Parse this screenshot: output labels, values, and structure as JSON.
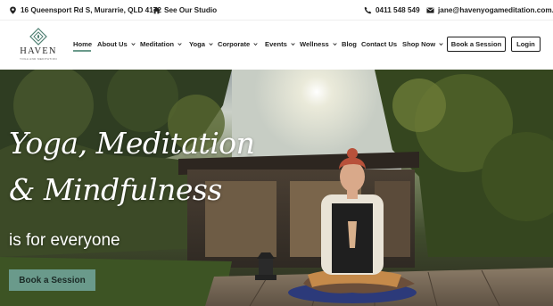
{
  "topbar": {
    "address": "16 Queensport Rd S, Murarrie, QLD 4172",
    "studio_link": "See Our Studio",
    "phone": "0411 548 549",
    "email": "jane@havenyogameditation.com.au"
  },
  "logo": {
    "name": "HAVEN",
    "tagline": "YOGA AND MEDITATION"
  },
  "nav": {
    "items": [
      {
        "label": "Home"
      },
      {
        "label": "About Us"
      },
      {
        "label": "Meditation"
      },
      {
        "label": "Yoga"
      },
      {
        "label": "Corporate"
      },
      {
        "label": "Events"
      },
      {
        "label": "Wellness"
      },
      {
        "label": "Blog"
      },
      {
        "label": "Contact Us"
      },
      {
        "label": "Shop Now"
      }
    ],
    "book_button": "Book a Session",
    "login_button": "Login"
  },
  "hero": {
    "headline_line1": "Yoga, Meditation",
    "headline_line2": "& Mindfulness",
    "tagline": "is for everyone",
    "button": "Book a Session"
  },
  "colors": {
    "accent": "#6a9a8b",
    "text": "#1f1f1f"
  }
}
